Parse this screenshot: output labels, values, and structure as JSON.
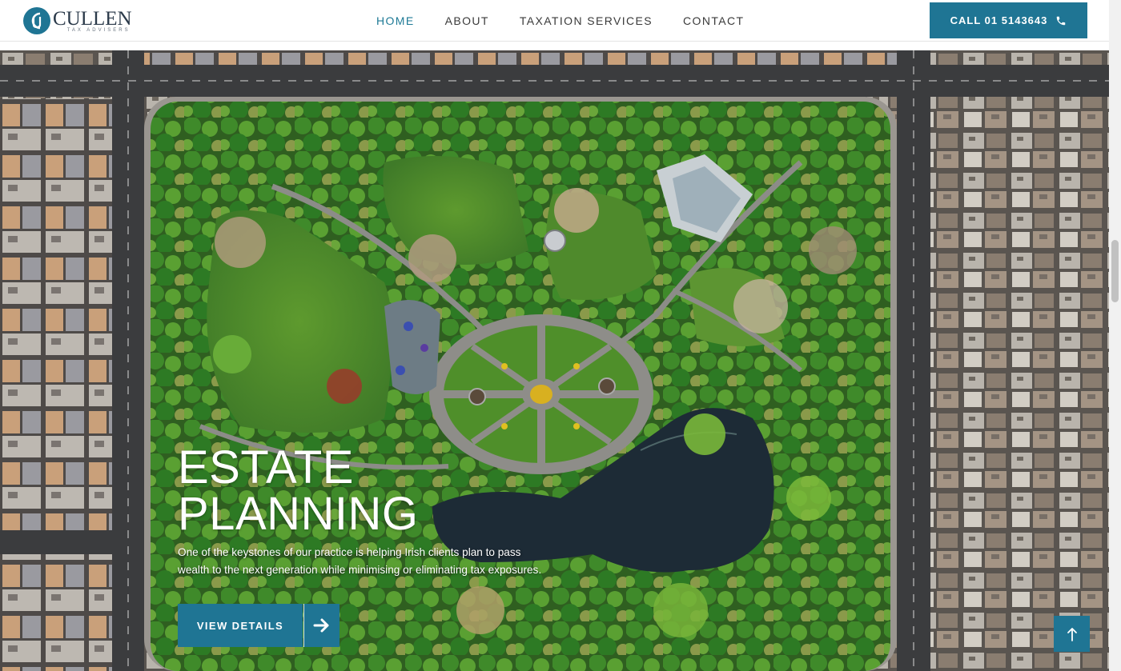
{
  "brand": {
    "name": "CULLEN",
    "tagline": "TAX ADVISERS",
    "accent_color": "#1f7594"
  },
  "nav": {
    "items": [
      {
        "label": "HOME",
        "active": true
      },
      {
        "label": "ABOUT",
        "active": false
      },
      {
        "label": "TAXATION SERVICES",
        "active": false
      },
      {
        "label": "CONTACT",
        "active": false
      }
    ]
  },
  "header": {
    "call_label": "CALL 01 5143643",
    "call_icon": "phone-icon"
  },
  "hero": {
    "title_line1": "ESTATE",
    "title_line2": "PLANNING",
    "text": "One of the keystones of our practice is helping Irish clients plan to pass wealth to the next generation while minimising or eliminating tax exposures.",
    "button_label": "VIEW DETAILS",
    "button_icon": "arrow-right-icon"
  },
  "back_to_top_icon": "arrow-up-icon"
}
